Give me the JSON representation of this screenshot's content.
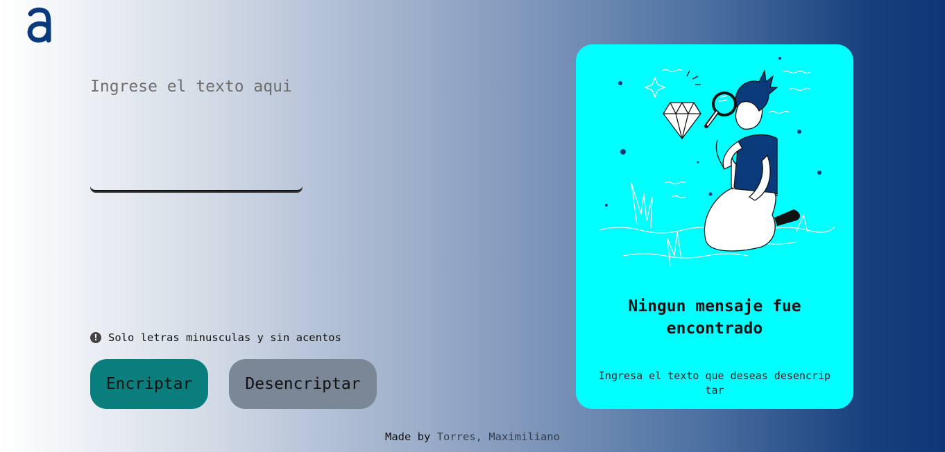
{
  "logo": {
    "icon": "alura-logo-icon",
    "color": "#0a3a7a"
  },
  "input": {
    "placeholder": "Ingrese el texto aqui",
    "value": ""
  },
  "notice": {
    "icon": "exclamation-circle-icon",
    "text": "Solo letras minusculas y sin acentos"
  },
  "buttons": {
    "encrypt": "Encriptar",
    "decrypt": "Desencriptar"
  },
  "result_card": {
    "illustration": "person-magnifying-glass-diamond-illustration",
    "title": "Ningun mensaje fue encontrado",
    "subtitle": "Ingresa el texto que deseas desencriptar"
  },
  "footer": {
    "prefix": "Made by",
    "author": "Torres, Maximiliano"
  },
  "colors": {
    "accent": "#0a7e7d",
    "secondary": "#7a8797",
    "card": "#00ffff",
    "brand": "#0a3a7a"
  }
}
